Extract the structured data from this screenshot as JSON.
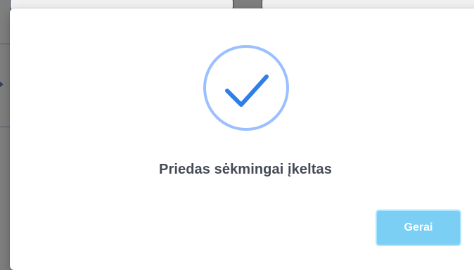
{
  "modal": {
    "message": "Priedas sėkmingai įkeltas",
    "ok_label": "Gerai"
  },
  "icons": {
    "success": "success-check-icon"
  },
  "colors": {
    "overlay": "#7f7f7f",
    "modal_bg": "#ffffff",
    "success_ring": "#9cc0ff",
    "success_check": "#2f7fe6",
    "text": "#444a56",
    "button_bg": "#7ccff4",
    "button_border": "#aee5ff",
    "button_text": "#ffffff"
  }
}
